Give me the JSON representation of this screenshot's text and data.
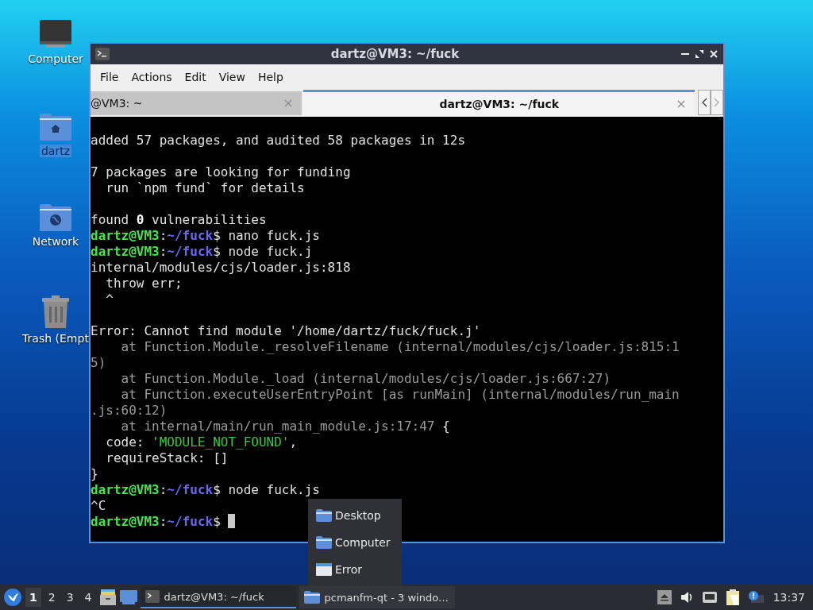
{
  "desktop_icons": [
    {
      "label": "Computer",
      "kind": "monitor",
      "selected": false
    },
    {
      "label": "dartz",
      "kind": "home",
      "selected": true
    },
    {
      "label": "Network",
      "kind": "network",
      "selected": false
    },
    {
      "label": "Trash (Empt",
      "kind": "trash",
      "selected": false
    }
  ],
  "window": {
    "title": "dartz@VM3: ~/fuck",
    "menu": [
      "File",
      "Actions",
      "Edit",
      "View",
      "Help"
    ],
    "tabs": [
      {
        "label": "@VM3: ~",
        "selected": false
      },
      {
        "label": "dartz@VM3: ~/fuck",
        "selected": true
      }
    ],
    "terminal": {
      "lines": [
        {
          "kind": "text",
          "segments": [
            {
              "text": "added 57 packages, and audited 58 packages in 12s",
              "kind": "plain"
            }
          ]
        },
        {
          "kind": "blank"
        },
        {
          "kind": "text",
          "segments": [
            {
              "text": "7 packages are looking for funding",
              "kind": "plain"
            }
          ]
        },
        {
          "kind": "text",
          "segments": [
            {
              "text": "  run `npm fund` for details",
              "kind": "plain"
            }
          ]
        },
        {
          "kind": "blank"
        },
        {
          "kind": "text",
          "segments": [
            {
              "text": "found ",
              "kind": "plain"
            },
            {
              "text": "0",
              "kind": "bold"
            },
            {
              "text": " vulnerabilities",
              "kind": "plain"
            }
          ]
        },
        {
          "kind": "text",
          "segments": [
            {
              "text": "dartz@VM3",
              "kind": "user"
            },
            {
              "text": ":",
              "kind": "plain"
            },
            {
              "text": "~/fuck",
              "kind": "path"
            },
            {
              "text": "$ nano fuck.js",
              "kind": "plain"
            }
          ]
        },
        {
          "kind": "text",
          "segments": [
            {
              "text": "dartz@VM3",
              "kind": "user"
            },
            {
              "text": ":",
              "kind": "plain"
            },
            {
              "text": "~/fuck",
              "kind": "path"
            },
            {
              "text": "$ node fuck.j",
              "kind": "plain"
            }
          ]
        },
        {
          "kind": "text",
          "segments": [
            {
              "text": "internal/modules/cjs/loader.js:818",
              "kind": "plain"
            }
          ]
        },
        {
          "kind": "text",
          "segments": [
            {
              "text": "  throw err;",
              "kind": "plain"
            }
          ]
        },
        {
          "kind": "text",
          "segments": [
            {
              "text": "  ^",
              "kind": "plain"
            }
          ]
        },
        {
          "kind": "blank"
        },
        {
          "kind": "text",
          "segments": [
            {
              "text": "Error: Cannot find module '/home/dartz/fuck/fuck.j'",
              "kind": "plain"
            }
          ]
        },
        {
          "kind": "text",
          "segments": [
            {
              "text": "    at Function.Module._resolveFilename (internal/modules/cjs/loader.js:815:1",
              "kind": "dim"
            }
          ]
        },
        {
          "kind": "text",
          "segments": [
            {
              "text": "5)",
              "kind": "dim"
            }
          ]
        },
        {
          "kind": "text",
          "segments": [
            {
              "text": "    at Function.Module._load (internal/modules/cjs/loader.js:667:27)",
              "kind": "dim"
            }
          ]
        },
        {
          "kind": "text",
          "segments": [
            {
              "text": "    at Function.executeUserEntryPoint [as runMain] (internal/modules/run_main",
              "kind": "dim"
            }
          ]
        },
        {
          "kind": "text",
          "segments": [
            {
              "text": ".js:60:12)",
              "kind": "dim"
            }
          ]
        },
        {
          "kind": "text",
          "segments": [
            {
              "text": "    at internal/main/run_main_module.js:17:47",
              "kind": "dim"
            },
            {
              "text": " {",
              "kind": "plain"
            }
          ]
        },
        {
          "kind": "text",
          "segments": [
            {
              "text": "  code: ",
              "kind": "plain"
            },
            {
              "text": "'MODULE_NOT_FOUND'",
              "kind": "string"
            },
            {
              "text": ",",
              "kind": "plain"
            }
          ]
        },
        {
          "kind": "text",
          "segments": [
            {
              "text": "  requireStack: []",
              "kind": "plain"
            }
          ]
        },
        {
          "kind": "text",
          "segments": [
            {
              "text": "}",
              "kind": "plain"
            }
          ]
        },
        {
          "kind": "text",
          "segments": [
            {
              "text": "dartz@VM3",
              "kind": "user"
            },
            {
              "text": ":",
              "kind": "plain"
            },
            {
              "text": "~/fuck",
              "kind": "path"
            },
            {
              "text": "$ node fuck.js",
              "kind": "plain"
            }
          ]
        },
        {
          "kind": "text",
          "segments": [
            {
              "text": "^C",
              "kind": "plain"
            }
          ]
        },
        {
          "kind": "text",
          "segments": [
            {
              "text": "dartz@VM3",
              "kind": "user"
            },
            {
              "text": ":",
              "kind": "plain"
            },
            {
              "text": "~/fuck",
              "kind": "path"
            },
            {
              "text": "$ ",
              "kind": "plain"
            }
          ],
          "cursor": true
        }
      ]
    }
  },
  "popup_menu": [
    {
      "label": "Desktop",
      "kind": "folder"
    },
    {
      "label": "Computer",
      "kind": "folder"
    },
    {
      "label": "Error",
      "kind": "window"
    }
  ],
  "taskbar": {
    "workspaces": [
      {
        "label": "1",
        "selected": true
      },
      {
        "label": "2",
        "selected": false
      },
      {
        "label": "3",
        "selected": false
      },
      {
        "label": "4",
        "selected": false
      }
    ],
    "tasks": [
      {
        "label": "dartz@VM3: ~/fuck",
        "kind": "terminal",
        "selected": true
      },
      {
        "label": "pcmanfm-qt - 3 windo…",
        "kind": "folder",
        "selected": false
      }
    ],
    "clock": "13:37"
  }
}
